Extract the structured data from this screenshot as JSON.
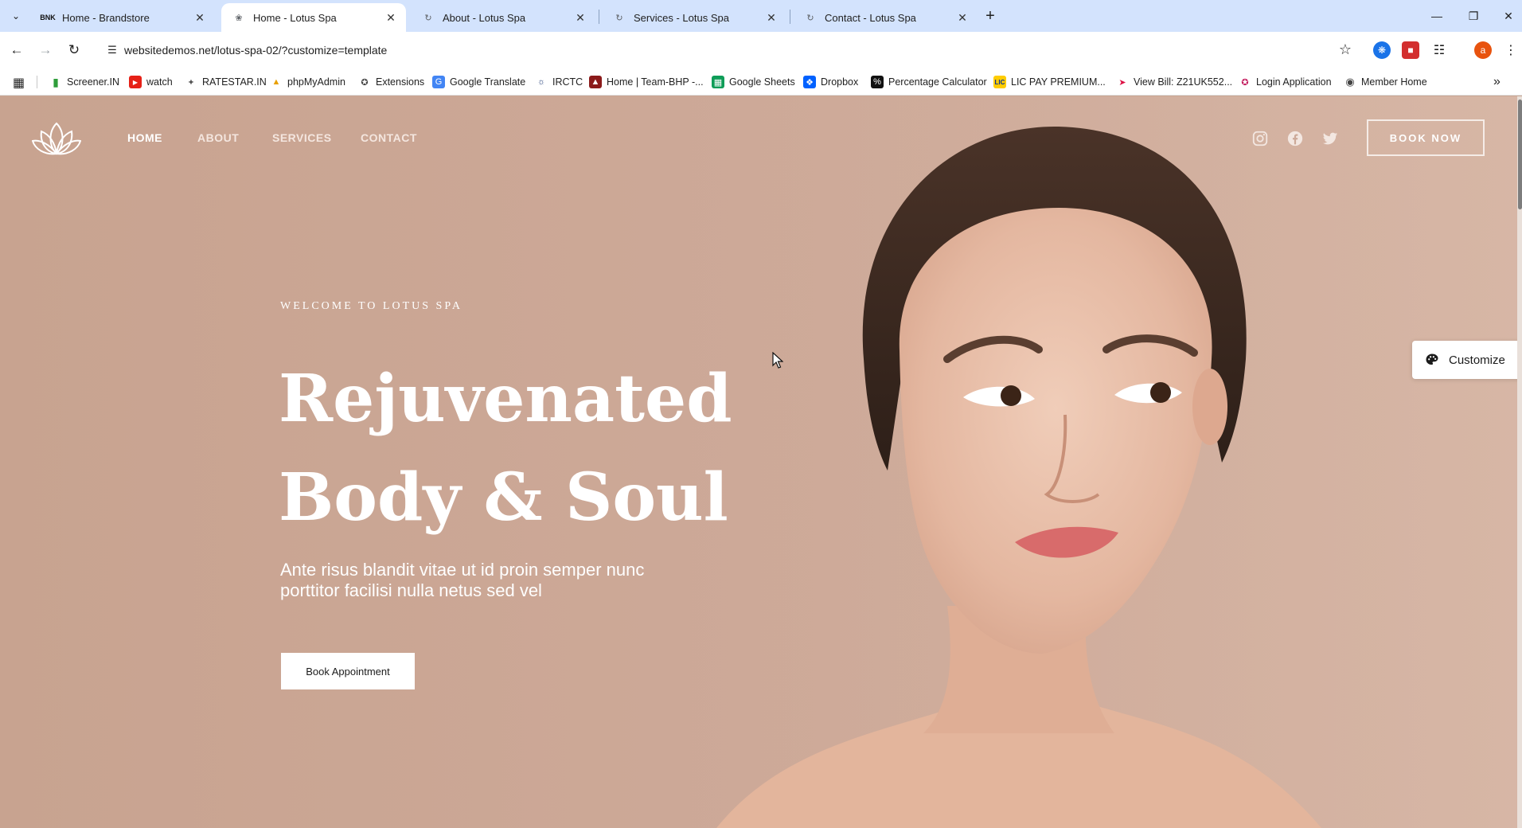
{
  "browser": {
    "tabs": [
      {
        "title": "Home - Brandstore",
        "favicon": "brandstore-icon"
      },
      {
        "title": "Home - Lotus Spa",
        "favicon": "lotus-icon",
        "active": true
      },
      {
        "title": "About - Lotus Spa",
        "favicon": "loading-icon"
      },
      {
        "title": "Services - Lotus Spa",
        "favicon": "loading-icon"
      },
      {
        "title": "Contact - Lotus Spa",
        "favicon": "loading-icon"
      }
    ],
    "url": "websitedemos.net/lotus-spa-02/?customize=template",
    "profile_initial": "a",
    "bookmarks": [
      {
        "label": "Screener.IN",
        "icon": "bar-chart-icon"
      },
      {
        "label": "watch",
        "icon": "youtube-icon"
      },
      {
        "label": "RATESTAR.IN",
        "icon": "ratestar-icon"
      },
      {
        "label": "phpMyAdmin",
        "icon": "phpmyadmin-icon"
      },
      {
        "label": "Extensions",
        "icon": "puzzle-icon"
      },
      {
        "label": "Google Translate",
        "icon": "translate-icon"
      },
      {
        "label": "IRCTC",
        "icon": "irctc-icon"
      },
      {
        "label": "Home | Team-BHP -...",
        "icon": "teambhp-icon"
      },
      {
        "label": "Google Sheets",
        "icon": "sheets-icon"
      },
      {
        "label": "Dropbox",
        "icon": "dropbox-icon"
      },
      {
        "label": "Percentage Calculator",
        "icon": "percent-icon"
      },
      {
        "label": "LIC PAY PREMIUM...",
        "icon": "lic-icon"
      },
      {
        "label": "View Bill: Z21UK552...",
        "icon": "bill-icon"
      },
      {
        "label": "Login Application",
        "icon": "login-icon"
      },
      {
        "label": "Member Home",
        "icon": "globe-icon"
      }
    ]
  },
  "site": {
    "nav": [
      "HOME",
      "ABOUT",
      "SERVICES",
      "CONTACT"
    ],
    "book_now": "BOOK NOW",
    "welcome": "WELCOME TO LOTUS SPA",
    "title_line1": "Rejuvenated",
    "title_line2": "Body & Soul",
    "subtitle": "Ante risus blandit vitae ut id proin semper nunc porttitor facilisi nulla netus sed vel",
    "cta": "Book Appointment",
    "customize": "Customize"
  },
  "colors": {
    "hero_bg": "#c9a592",
    "tabstrip": "#d3e3fd",
    "accent_profile": "#e8530e"
  }
}
